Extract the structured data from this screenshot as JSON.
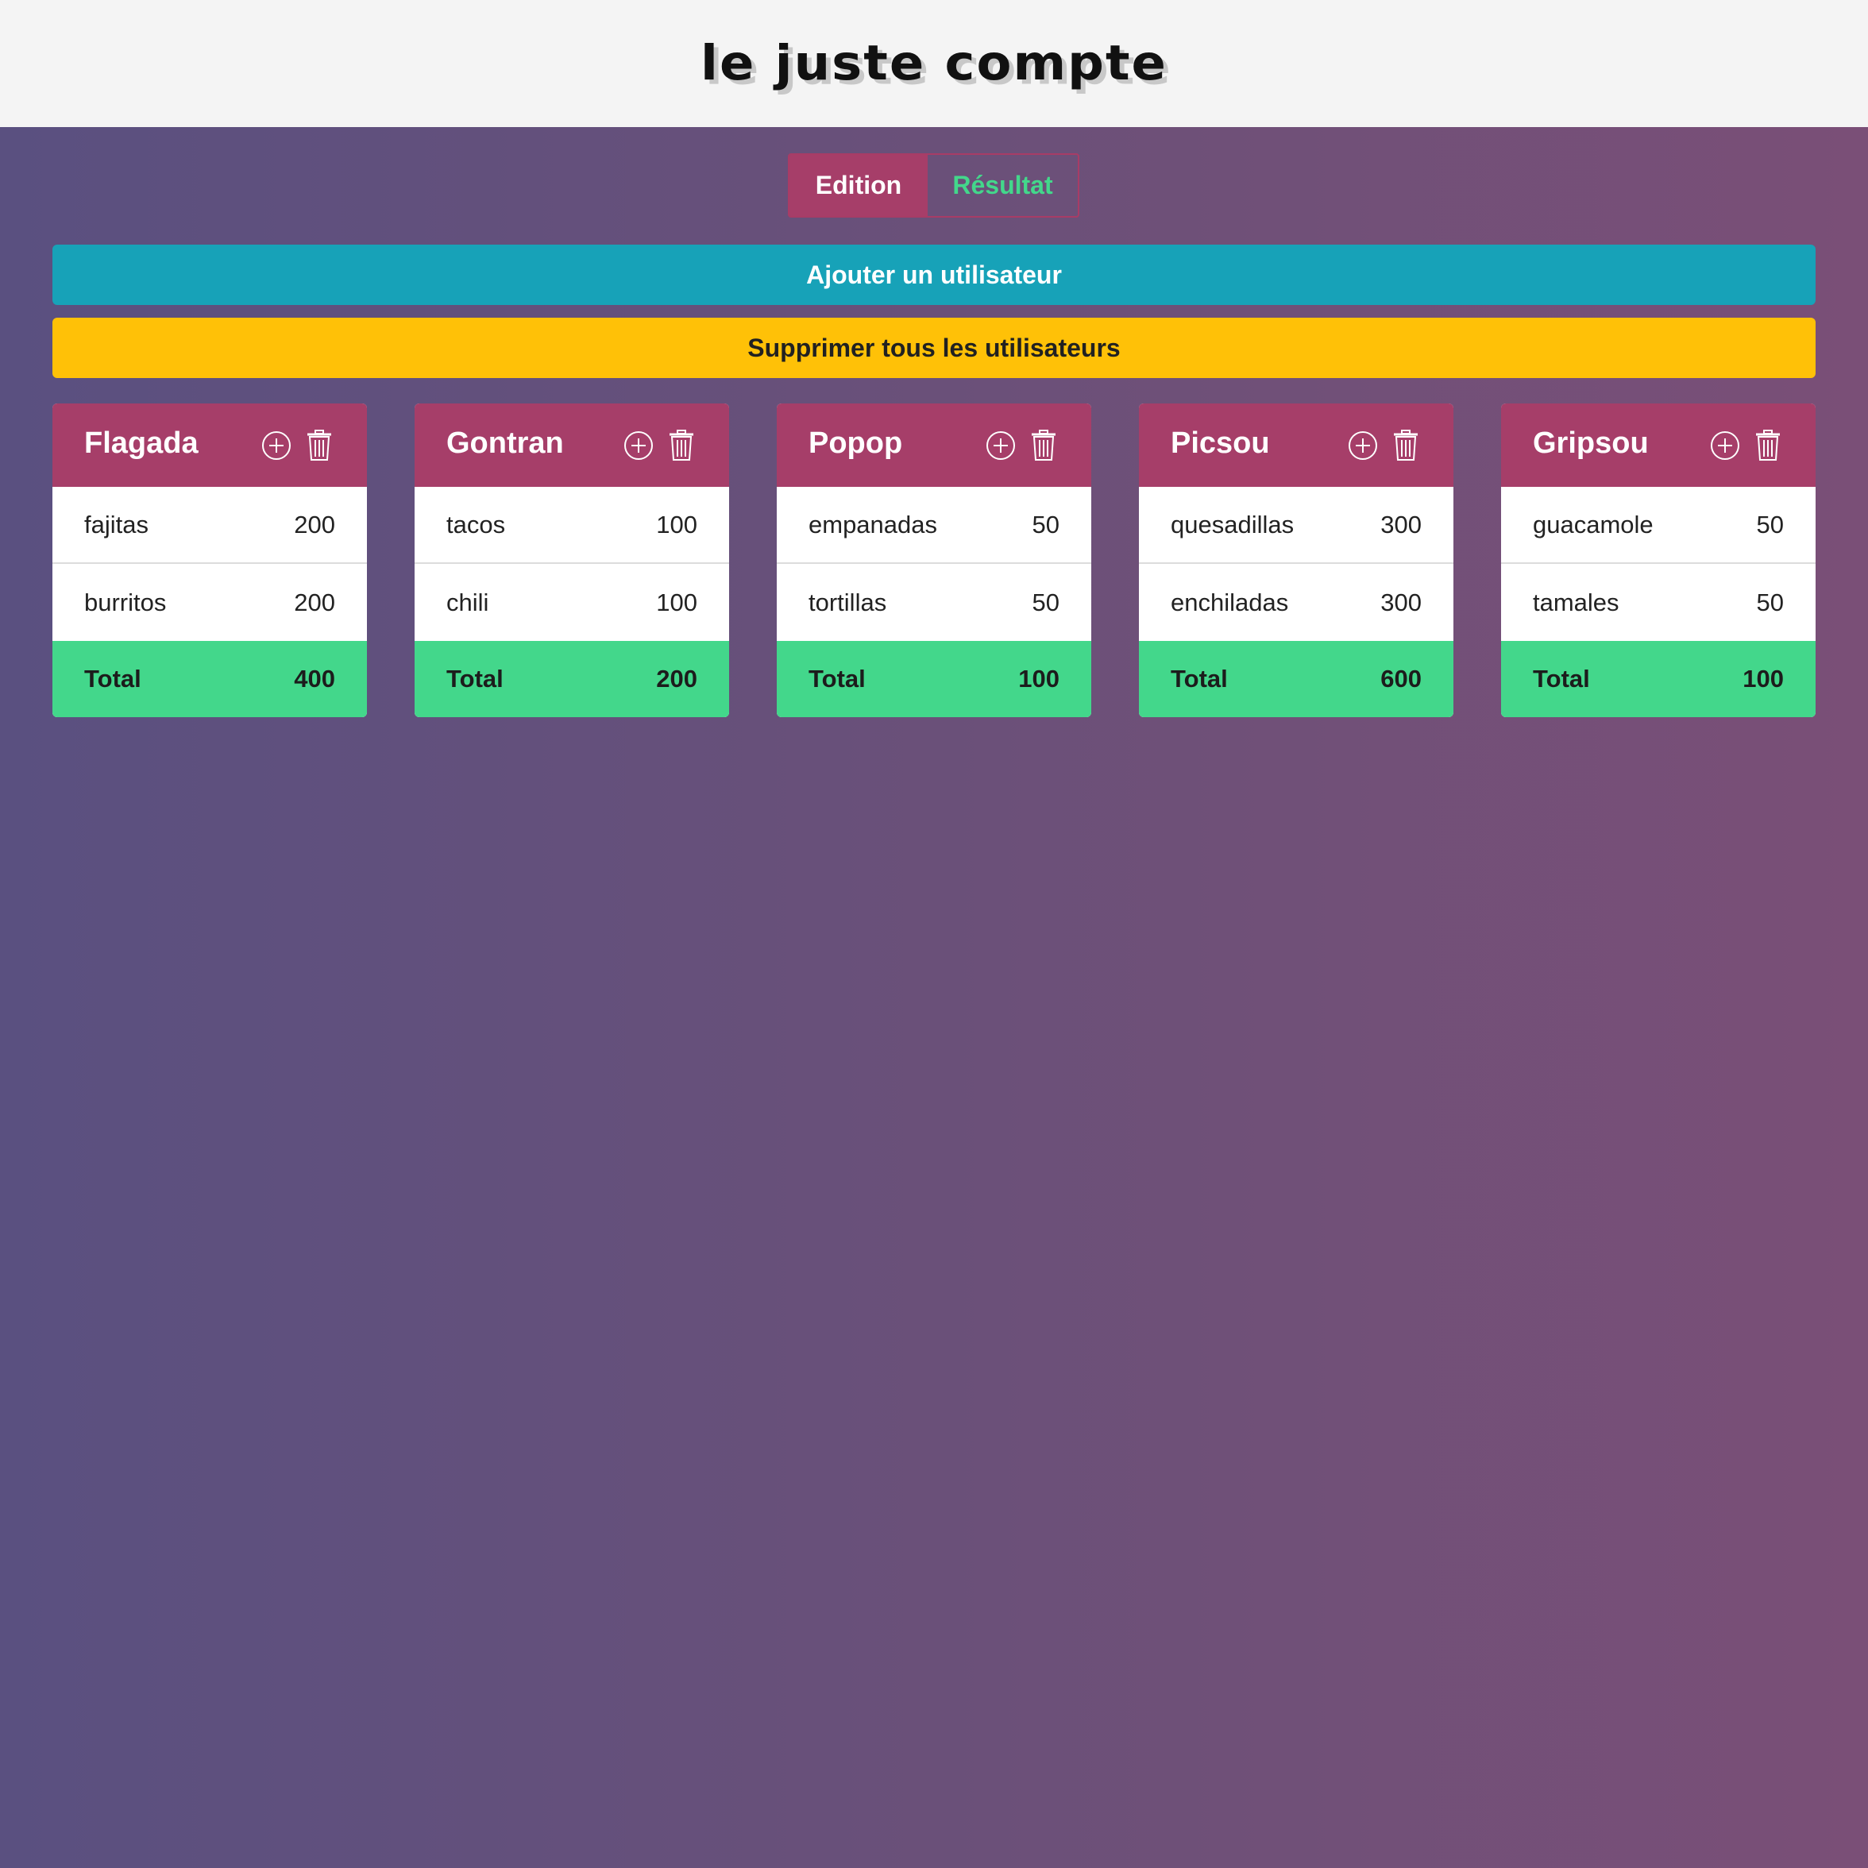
{
  "header": {
    "title": "le juste compte"
  },
  "tabs": [
    {
      "label": "Edition",
      "active": true
    },
    {
      "label": "Résultat",
      "active": false
    }
  ],
  "actions": {
    "add_user": "Ajouter un utilisateur",
    "delete_all": "Supprimer tous les utilisateurs"
  },
  "colors": {
    "header_bg": "#f4f4f4",
    "card_header": "#a63e69",
    "add_button": "#17a2b8",
    "delete_button": "#ffc107",
    "total_row": "#43d78b",
    "inactive_tab_text": "#43d78b"
  },
  "icons": {
    "add": "plus-circle-icon",
    "delete": "trash-icon"
  },
  "total_label": "Total",
  "users": [
    {
      "name": "Flagada",
      "items": [
        {
          "label": "fajitas",
          "amount": "200"
        },
        {
          "label": "burritos",
          "amount": "200"
        }
      ],
      "total": "400"
    },
    {
      "name": "Gontran",
      "items": [
        {
          "label": "tacos",
          "amount": "100"
        },
        {
          "label": "chili",
          "amount": "100"
        }
      ],
      "total": "200"
    },
    {
      "name": "Popop",
      "items": [
        {
          "label": "empanadas",
          "amount": "50"
        },
        {
          "label": "tortillas",
          "amount": "50"
        }
      ],
      "total": "100"
    },
    {
      "name": "Picsou",
      "items": [
        {
          "label": "quesadillas",
          "amount": "300"
        },
        {
          "label": "enchiladas",
          "amount": "300"
        }
      ],
      "total": "600"
    },
    {
      "name": "Gripsou",
      "items": [
        {
          "label": "guacamole",
          "amount": "50"
        },
        {
          "label": "tamales",
          "amount": "50"
        }
      ],
      "total": "100"
    }
  ]
}
